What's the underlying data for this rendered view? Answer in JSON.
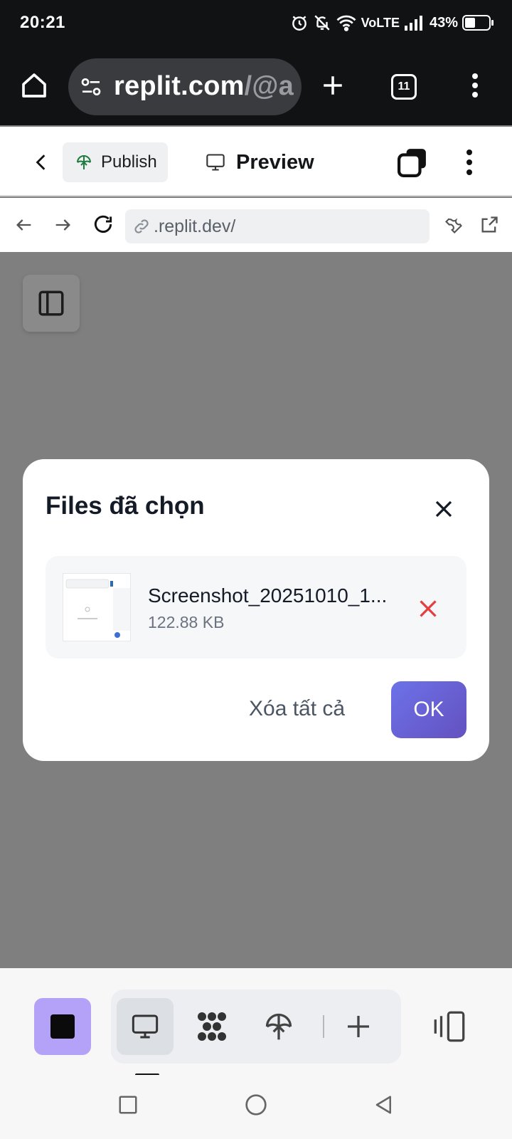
{
  "status_bar": {
    "time": "20:21",
    "network": "VoLTE",
    "battery_percent": "43%",
    "icons": [
      "alarm-icon",
      "bell-off-icon",
      "wifi-icon",
      "signal-icon",
      "battery-icon"
    ]
  },
  "browser": {
    "url_host": "replit.com",
    "url_path": "/@a",
    "tab_count": "11",
    "icons": [
      "home-icon",
      "site-settings-icon",
      "new-tab-icon",
      "tab-switcher-icon",
      "more-vert-icon"
    ]
  },
  "app_header": {
    "publish_label": "Publish",
    "preview_label": "Preview",
    "icons": [
      "back-chevron-icon",
      "publish-icon",
      "monitor-icon",
      "workspace-icon",
      "more-vert-icon"
    ]
  },
  "address_bar": {
    "url": ".replit.dev/",
    "icons": [
      "back-arrow-icon",
      "forward-arrow-icon",
      "reload-icon",
      "link-icon",
      "wrench-icon",
      "open-external-icon"
    ]
  },
  "modal": {
    "title": "Files đã chọn",
    "files": [
      {
        "name": "Screenshot_20251010_1...",
        "size": "122.88 KB"
      }
    ],
    "clear_all_label": "Xóa tất cả",
    "ok_label": "OK"
  },
  "bottom_toolbar": {
    "active_tool": "preview",
    "tools": [
      "stop-icon",
      "monitor-icon",
      "agent-icon",
      "publish-icon",
      "plus-icon",
      "panels-icon"
    ]
  },
  "nav_bar": {
    "icons": [
      "recents-square-icon",
      "home-circle-icon",
      "back-triangle-icon"
    ]
  },
  "colors": {
    "overlay": "#7f7f7f",
    "ok_gradient_start": "#6c72e8",
    "ok_gradient_end": "#6451c0",
    "remove_red": "#e53e3e",
    "stop_purple": "#b4a2f8"
  }
}
